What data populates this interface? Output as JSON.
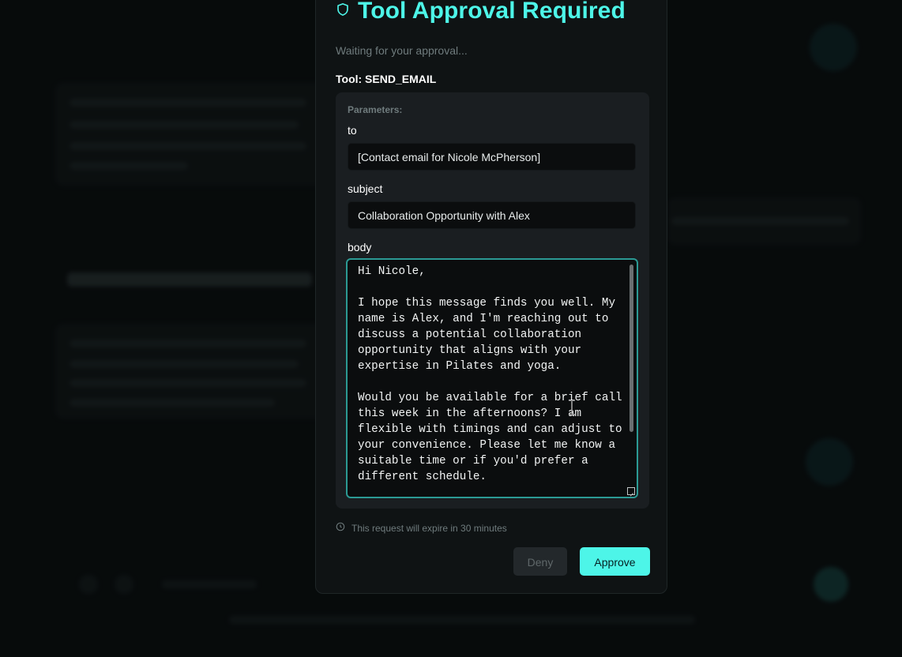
{
  "modal": {
    "title": "Tool Approval Required",
    "subtitle": "Waiting for your approval...",
    "tool_label": "Tool: SEND_EMAIL",
    "params_title": "Parameters:",
    "fields": {
      "to": {
        "label": "to",
        "value": "[Contact email for Nicole McPherson]"
      },
      "subject": {
        "label": "subject",
        "value": "Collaboration Opportunity with Alex"
      },
      "body": {
        "label": "body",
        "value": "Hi Nicole,\n\nI hope this message finds you well. My name is Alex, and I'm reaching out to discuss a potential collaboration opportunity that aligns with your expertise in Pilates and yoga.\n\nWould you be available for a brief call this week in the afternoons? I am flexible with timings and can adjust to your convenience. Please let me know a suitable time or if you'd prefer a different schedule."
      }
    },
    "expire_text": "This request will expire in 30 minutes",
    "deny_label": "Deny",
    "approve_label": "Approve"
  },
  "colors": {
    "accent": "#4df5e8",
    "focus_border": "#2b9a94",
    "background": "#0c1112"
  },
  "icons": {
    "title_icon": "shield-icon",
    "expire_icon": "clock-icon"
  }
}
